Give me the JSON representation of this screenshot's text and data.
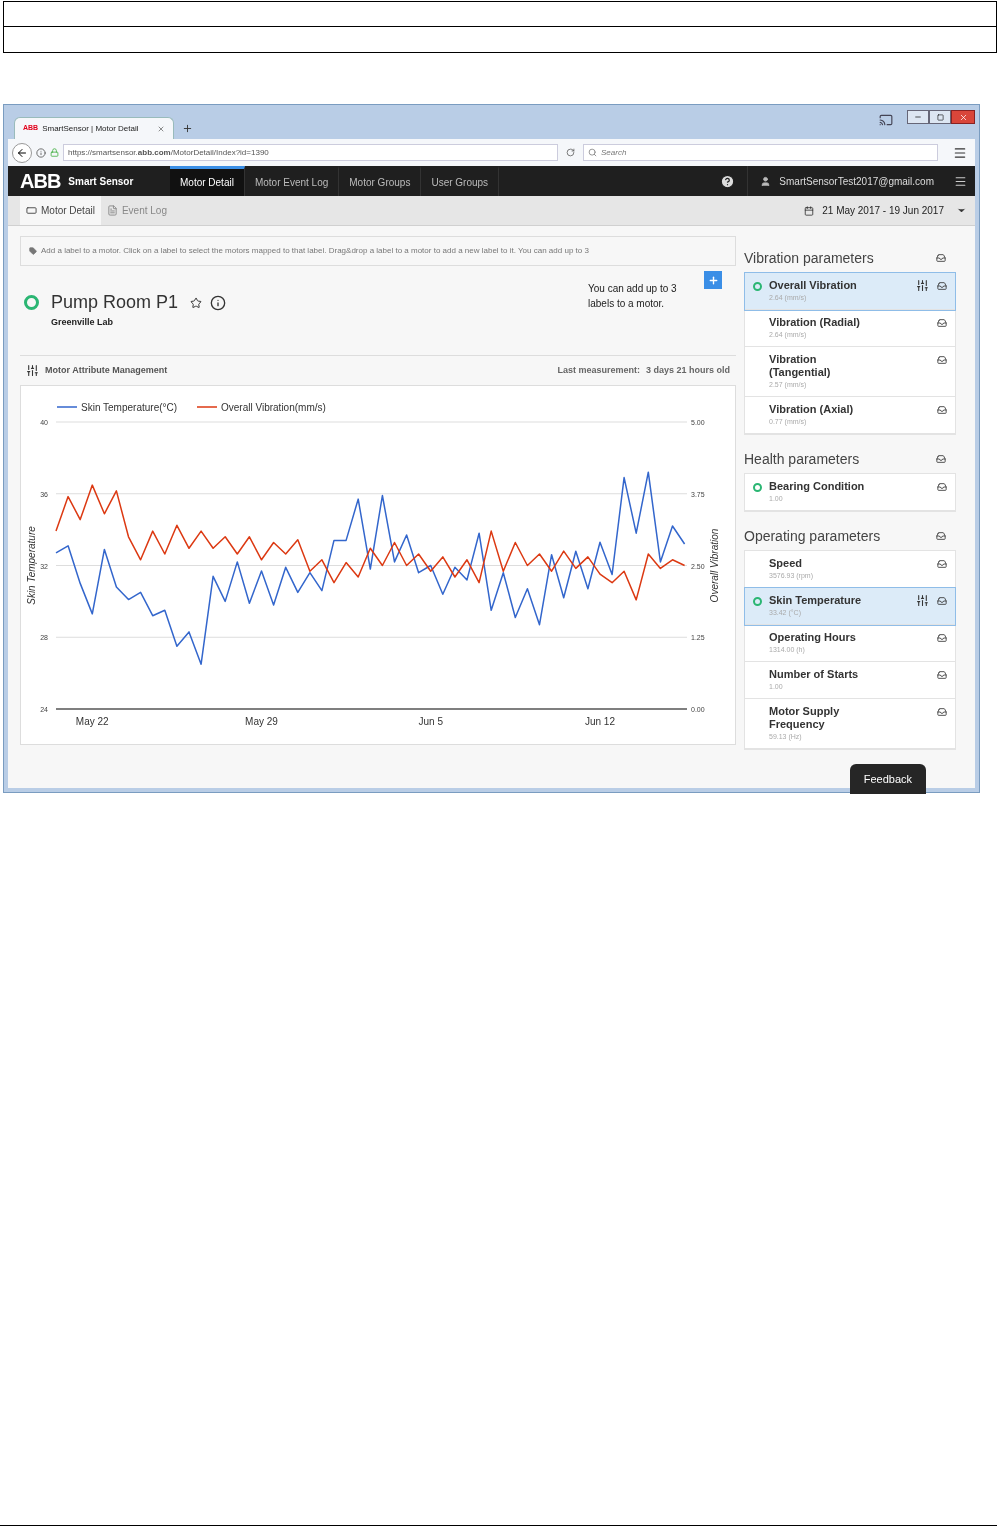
{
  "browser": {
    "favicon": "ABB",
    "tab_title": "SmartSensor | Motor Detail",
    "url": "https://smartsensor.**abb.com**/MotorDetail/Index?id=1390",
    "search_placeholder": "Search"
  },
  "nav": {
    "brand": "ABB",
    "product": "Smart Sensor",
    "items": [
      {
        "label": "Motor Detail",
        "selected": true
      },
      {
        "label": "Motor Event Log",
        "selected": false
      },
      {
        "label": "Motor Groups",
        "selected": false
      },
      {
        "label": "User Groups",
        "selected": false
      }
    ],
    "user": "SmartSensorTest2017@gmail.com"
  },
  "subnav": {
    "tabs": [
      {
        "label": "Motor Detail",
        "kind": "motor",
        "selected": true
      },
      {
        "label": "Event Log",
        "kind": "log",
        "selected": false
      }
    ],
    "date_range": "21 May 2017 - 19 Jun 2017"
  },
  "hint": "Add a label to a motor. Click on a label to select the motors mapped to that label. Drag&drop a label to a motor to add a new label to it. You can add up to 3",
  "motor": {
    "name": "Pump Room P1",
    "location": "Greenville Lab",
    "label_note": "You can add up to 3 labels to a motor."
  },
  "attributes": {
    "title": "Motor Attribute Management",
    "last_label": "Last measurement:",
    "last_value": "3 days 21 hours old"
  },
  "chart_data": {
    "type": "line",
    "grid": true,
    "legend": "top",
    "ylabel": "Skin Temperature",
    "y2label": "Overall Vibration",
    "categories": [
      null,
      null,
      null,
      "May 22",
      null,
      null,
      null,
      null,
      null,
      null,
      null,
      null,
      null,
      null,
      null,
      null,
      null,
      "May 29",
      null,
      null,
      null,
      null,
      null,
      null,
      null,
      null,
      null,
      null,
      null,
      null,
      null,
      "Jun 5",
      null,
      null,
      null,
      null,
      null,
      null,
      null,
      null,
      null,
      null,
      null,
      null,
      null,
      "Jun 12",
      null,
      null,
      null,
      null,
      null,
      null,
      null
    ],
    "series": [
      {
        "name": "Skin Temperature(°C)",
        "color": "#3366cc",
        "values": [
          32.7,
          33.1,
          31.0,
          29.3,
          32.9,
          30.8,
          30.1,
          30.5,
          29.2,
          29.5,
          27.5,
          28.3,
          26.5,
          31.4,
          30.0,
          32.2,
          29.9,
          31.7,
          29.8,
          31.9,
          30.5,
          31.6,
          30.6,
          33.4,
          33.4,
          35.7,
          31.8,
          35.9,
          32.2,
          33.7,
          31.6,
          32.0,
          30.4,
          31.9,
          31.2,
          33.8,
          29.5,
          31.6,
          29.1,
          30.7,
          28.7,
          32.6,
          30.2,
          32.8,
          30.7,
          33.3,
          31.5,
          36.9,
          33.8,
          37.2,
          32.2,
          34.2,
          33.2
        ]
      },
      {
        "name": "Overall Vibration(mm/s)",
        "color": "#dc3912",
        "axis": "y2",
        "values": [
          3.1,
          3.7,
          3.3,
          3.9,
          3.4,
          3.8,
          3.0,
          2.6,
          3.1,
          2.7,
          3.2,
          2.8,
          3.1,
          2.8,
          3.0,
          2.7,
          3.0,
          2.6,
          2.9,
          2.7,
          2.95,
          2.4,
          2.6,
          2.2,
          2.55,
          2.3,
          2.8,
          2.5,
          2.9,
          2.5,
          2.7,
          2.4,
          2.65,
          2.3,
          2.6,
          2.2,
          3.1,
          2.4,
          2.9,
          2.5,
          2.7,
          2.4,
          2.75,
          2.45,
          2.65,
          2.35,
          2.2,
          2.4,
          1.9,
          2.7,
          2.45,
          2.6,
          2.5
        ]
      }
    ],
    "ylim": [
      24,
      40
    ],
    "yticks": [
      24,
      28,
      32,
      36,
      40
    ],
    "y2lim": [
      0,
      5
    ],
    "y2ticks": [
      {
        "value": 0,
        "label": "0.00"
      },
      {
        "value": 1.25,
        "label": "1.25"
      },
      {
        "value": 2.5,
        "label": "2.50"
      },
      {
        "value": 3.75,
        "label": "3.75"
      },
      {
        "value": 5,
        "label": "5.00"
      }
    ]
  },
  "sections": [
    {
      "title": "Vibration parameters",
      "params": [
        {
          "name": "Overall Vibration",
          "value": "2.64 (mm/s)",
          "selected": true,
          "indicator": true
        },
        {
          "name": "Vibration (Radial)",
          "value": "2.64 (mm/s)",
          "selected": false,
          "indicator": false
        },
        {
          "name": "Vibration (Tangential)",
          "value": "2.57 (mm/s)",
          "selected": false,
          "indicator": false
        },
        {
          "name": "Vibration (Axial)",
          "value": "0.77 (mm/s)",
          "selected": false,
          "indicator": false
        }
      ]
    },
    {
      "title": "Health parameters",
      "params": [
        {
          "name": "Bearing Condition",
          "value": "1.00",
          "selected": false,
          "indicator": true
        }
      ]
    },
    {
      "title": "Operating parameters",
      "params": [
        {
          "name": "Speed",
          "value": "3576.93 (rpm)",
          "selected": false,
          "indicator": false
        },
        {
          "name": "Skin Temperature",
          "value": "33.42 (°C)",
          "selected": true,
          "indicator": true
        },
        {
          "name": "Operating Hours",
          "value": "1314.00 (h)",
          "selected": false,
          "indicator": false
        },
        {
          "name": "Number of Starts",
          "value": "1.00",
          "selected": false,
          "indicator": false
        },
        {
          "name": "Motor Supply Frequency",
          "value": "59.13 (Hz)",
          "selected": false,
          "indicator": false
        }
      ]
    }
  ],
  "feedback": "Feedback"
}
